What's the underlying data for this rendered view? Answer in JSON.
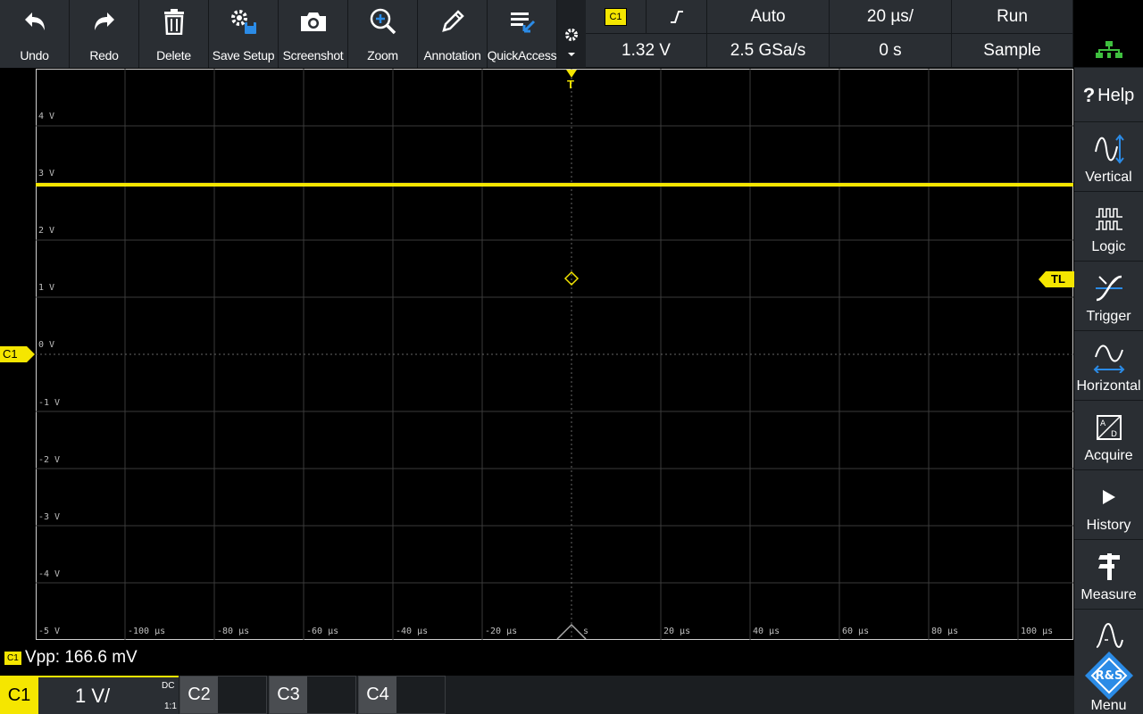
{
  "toolbar": {
    "items": [
      {
        "label": "Undo",
        "icon": "undo-icon"
      },
      {
        "label": "Redo",
        "icon": "redo-icon"
      },
      {
        "label": "Delete",
        "icon": "trash-icon"
      },
      {
        "label": "Save Setup",
        "icon": "save-setup-icon"
      },
      {
        "label": "Screenshot",
        "icon": "camera-icon"
      },
      {
        "label": "Zoom",
        "icon": "zoom-icon"
      },
      {
        "label": "Annotation",
        "icon": "pencil-icon"
      },
      {
        "label": "QuickAccess",
        "icon": "quickaccess-icon"
      }
    ]
  },
  "status": {
    "trigger_source": "C1",
    "trigger_mode": "Auto",
    "time_scale": "20 µs/",
    "run_state": "Run",
    "trigger_level": "1.32 V",
    "sample_rate": "2.5 GSa/s",
    "horizontal_position": "0 s",
    "acquire_mode": "Sample"
  },
  "sidebar": {
    "items": [
      {
        "label": "Help",
        "icon": "help-icon"
      },
      {
        "label": "Vertical",
        "icon": "vertical-icon"
      },
      {
        "label": "Logic",
        "icon": "logic-icon"
      },
      {
        "label": "Trigger",
        "icon": "trigger-icon"
      },
      {
        "label": "Horizontal",
        "icon": "horizontal-icon"
      },
      {
        "label": "Acquire",
        "icon": "acquire-icon"
      },
      {
        "label": "History",
        "icon": "play-icon"
      },
      {
        "label": "Measure",
        "icon": "caliper-icon"
      },
      {
        "label": "",
        "icon": "waveform-icon"
      }
    ],
    "menu_label": "Menu",
    "logo_text": "R&S"
  },
  "graticule": {
    "y_labels": [
      "4 V",
      "3 V",
      "2 V",
      "1 V",
      "0 V",
      "-1 V",
      "-2 V",
      "-3 V",
      "-4 V",
      "-5 V"
    ],
    "x_labels": [
      "-100 µs",
      "-80 µs",
      "-60 µs",
      "-40 µs",
      "-20 µs",
      "s",
      "20 µs",
      "40 µs",
      "60 µs",
      "80 µs",
      "100 µs"
    ],
    "trigger_marker": "T",
    "trigger_level_marker": "TL",
    "channel_marker": "C1"
  },
  "waveform": {
    "channel": "C1",
    "level_volts": 2.9,
    "color": "#f5e600"
  },
  "measurement": {
    "channel": "C1",
    "text": "Vpp: 166.6 mV"
  },
  "channels": {
    "c1": {
      "label": "C1",
      "scale": "1 V/",
      "coupling": "DC",
      "probe": "1:1"
    },
    "c2": {
      "label": "C2"
    },
    "c3": {
      "label": "C3"
    },
    "c4": {
      "label": "C4"
    }
  },
  "colors": {
    "ch1": "#f5e600",
    "accent": "#2b8be6",
    "network": "#3fbf3f"
  }
}
